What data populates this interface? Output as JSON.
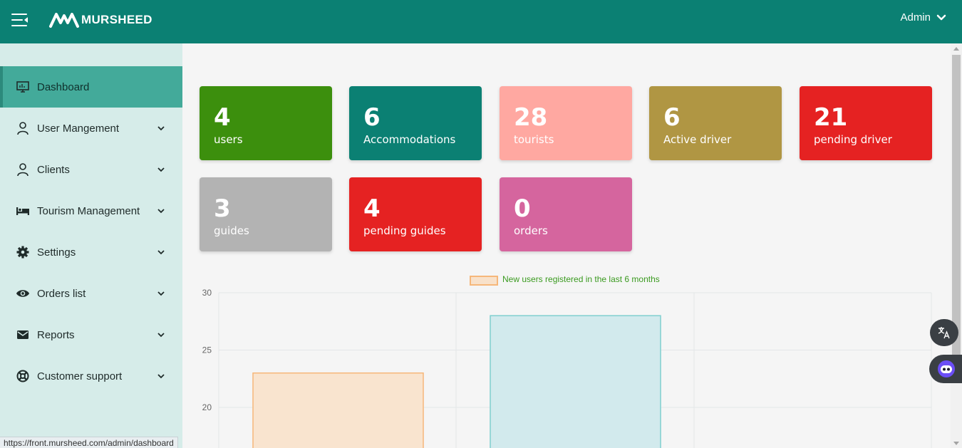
{
  "header": {
    "logo_text": "MURSHEED",
    "user_label": "Admin"
  },
  "sidebar": {
    "items": [
      {
        "label": "Dashboard",
        "icon": "monitor-icon",
        "active": true
      },
      {
        "label": "User Mangement",
        "icon": "user-icon"
      },
      {
        "label": "Clients",
        "icon": "user-icon"
      },
      {
        "label": "Tourism Management",
        "icon": "bed-icon"
      },
      {
        "label": "Settings",
        "icon": "gear-icon"
      },
      {
        "label": "Orders list",
        "icon": "eye-icon"
      },
      {
        "label": "Reports",
        "icon": "envelope-icon"
      },
      {
        "label": "Customer support",
        "icon": "lifebuoy-icon"
      }
    ]
  },
  "status_url": "https://front.mursheed.com/admin/dashboard",
  "cards": [
    {
      "count": "4",
      "label": "users",
      "color": "#3c8f0d"
    },
    {
      "count": "6",
      "label": "Accommodations",
      "color": "#0b8073"
    },
    {
      "count": "28",
      "label": "tourists",
      "color": "#ffa8a1"
    },
    {
      "count": "6",
      "label": "Active driver",
      "color": "#b09643"
    },
    {
      "count": "21",
      "label": "pending driver",
      "color": "#e52222"
    },
    {
      "count": "3",
      "label": "guides",
      "color": "#b3b3b3"
    },
    {
      "count": "4",
      "label": "pending guides",
      "color": "#e52222"
    },
    {
      "count": "0",
      "label": "orders",
      "color": "#d5659e"
    }
  ],
  "chart_data": {
    "type": "bar",
    "legend": "New users registered in the last 6 months",
    "series": [
      {
        "name": "New users registered in the last 6 months",
        "values": [
          23,
          28
        ]
      }
    ],
    "bar_colors": [
      "#f9e4cf",
      "#d2eaed"
    ],
    "bar_borders": [
      "#f6b77a",
      "#7fcfcf"
    ],
    "y_ticks": [
      "30",
      "25",
      "20"
    ],
    "ylim_visible": [
      18,
      30
    ],
    "grid": true,
    "legend_position": "top-center"
  },
  "colors": {
    "topbar": "#0b8073",
    "sidebar": "#d6ece9",
    "sidebar_active": "#43aa9a"
  }
}
